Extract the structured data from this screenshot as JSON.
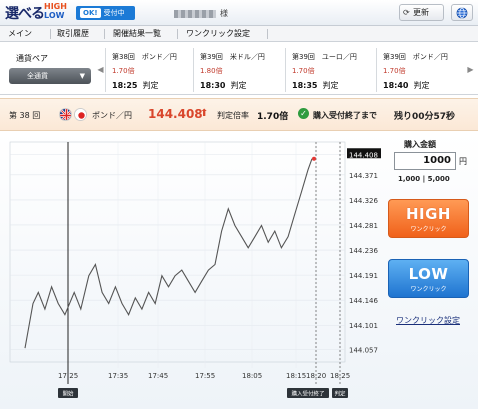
{
  "header": {
    "logo_main": "選べる",
    "logo_high": "HIGH",
    "logo_low": "LOW",
    "status_ok": "OK!",
    "status_text": "受付中",
    "user_suffix": "様",
    "refresh_label": "更新",
    "refresh_icon": "refresh-icon",
    "globe_icon": "globe-icon"
  },
  "nav": {
    "items": [
      "メイン",
      "取引履歴",
      "開催結果一覧",
      "ワンクリック設定"
    ]
  },
  "strip": {
    "pair_label": "通貨ペア",
    "pair_select": "全通貨",
    "cards": [
      {
        "title": "第38回　ポンド／円",
        "payout": "1.70倍",
        "time": "18:25",
        "judge": "判定"
      },
      {
        "title": "第39回　米ドル／円",
        "payout": "1.80倍",
        "time": "18:30",
        "judge": "判定"
      },
      {
        "title": "第39回　ユーロ／円",
        "payout": "1.70倍",
        "time": "18:35",
        "judge": "判定"
      },
      {
        "title": "第39回　ポンド／円",
        "payout": "1.70倍",
        "time": "18:40",
        "judge": "判定"
      }
    ]
  },
  "round": {
    "round_label": "第 38 回",
    "pair_name": "ポンド／円",
    "price": "144.408",
    "payout_label": "判定倍率",
    "payout_value": "1.70倍",
    "cutoff_label": "購入受付終了まで",
    "remaining": "残り00分57秒"
  },
  "panel": {
    "amount_label": "購入金額",
    "amount_value": "1000",
    "yen": "円",
    "range": "1,000 | 5,000",
    "high_label": "HIGH",
    "high_sub": "ワンクリック",
    "low_label": "LOW",
    "low_sub": "ワンクリック",
    "oneclick_link": "ワンクリック設定"
  },
  "chart_data": {
    "type": "line",
    "y_ticks": [
      "144.408",
      "144.371",
      "144.326",
      "144.281",
      "144.236",
      "144.191",
      "144.146",
      "144.101",
      "144.057"
    ],
    "ylim": [
      144.035,
      144.43
    ],
    "x_ticks": [
      "17:25",
      "17:35",
      "17:45",
      "17:55",
      "18:05",
      "18:15",
      "18:20",
      "18:25"
    ],
    "current_price": "144.408",
    "markers": {
      "open": "開始",
      "cutoff": "購入受付終了",
      "judge": "判定"
    },
    "series": [
      {
        "values": [
          [
            17.3,
            144.06
          ],
          [
            17.33,
            144.1
          ],
          [
            17.36,
            144.14
          ],
          [
            17.4,
            144.16
          ],
          [
            17.45,
            144.13
          ],
          [
            17.5,
            144.17
          ],
          [
            17.55,
            144.14
          ],
          [
            17.6,
            144.12
          ],
          [
            17.67,
            144.16
          ],
          [
            17.72,
            144.13
          ],
          [
            17.78,
            144.19
          ],
          [
            17.83,
            144.21
          ],
          [
            17.88,
            144.16
          ],
          [
            17.93,
            144.14
          ],
          [
            17.98,
            144.17
          ],
          [
            18.03,
            144.14
          ],
          [
            18.08,
            144.12
          ],
          [
            18.13,
            144.15
          ],
          [
            18.18,
            144.13
          ],
          [
            18.23,
            144.16
          ],
          [
            18.28,
            144.14
          ],
          [
            18.33,
            144.19
          ],
          [
            18.38,
            144.17
          ],
          [
            18.43,
            144.19
          ],
          [
            18.48,
            144.2
          ],
          [
            18.53,
            144.18
          ],
          [
            18.58,
            144.16
          ],
          [
            18.63,
            144.18
          ],
          [
            18.68,
            144.2
          ],
          [
            18.73,
            144.21
          ],
          [
            18.78,
            144.27
          ],
          [
            18.83,
            144.31
          ],
          [
            18.88,
            144.28
          ],
          [
            18.93,
            144.26
          ],
          [
            18.98,
            144.24
          ],
          [
            19.03,
            144.26
          ],
          [
            19.08,
            144.28
          ],
          [
            19.13,
            144.25
          ],
          [
            19.18,
            144.27
          ],
          [
            19.23,
            144.24
          ],
          [
            19.28,
            144.26
          ],
          [
            19.33,
            144.3
          ],
          [
            19.38,
            144.34
          ],
          [
            19.43,
            144.38
          ],
          [
            19.46,
            144.4
          ]
        ]
      }
    ]
  }
}
